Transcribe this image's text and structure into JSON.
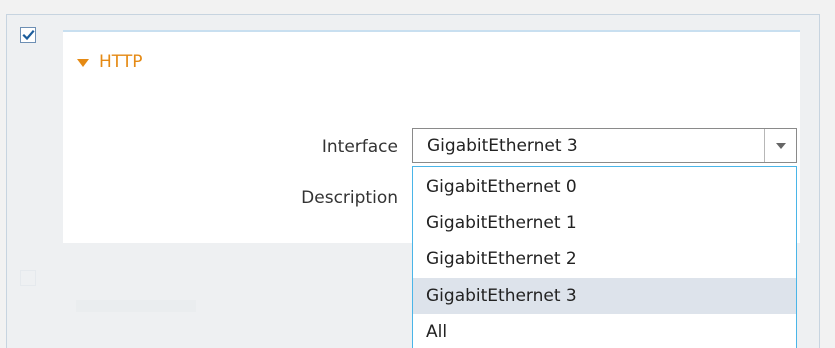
{
  "checkbox": {
    "checked": true
  },
  "section": {
    "title": "HTTP",
    "expanded": true
  },
  "form": {
    "interface_label": "Interface",
    "description_label": "Description",
    "interface_value": "GigabitEthernet 3"
  },
  "dropdown": {
    "options": [
      {
        "label": "GigabitEthernet 0",
        "selected": false
      },
      {
        "label": "GigabitEthernet 1",
        "selected": false
      },
      {
        "label": "GigabitEthernet 2",
        "selected": false
      },
      {
        "label": "GigabitEthernet 3",
        "selected": true
      },
      {
        "label": "All",
        "selected": false
      }
    ]
  },
  "colors": {
    "accent_orange": "#e58a14",
    "dropdown_border": "#4ab5e8",
    "selected_option_bg": "#dde3eb"
  },
  "icons": {
    "checkbox_check": "check-icon",
    "section_toggle": "triangle-down-icon",
    "select_arrow": "chevron-down-icon"
  }
}
